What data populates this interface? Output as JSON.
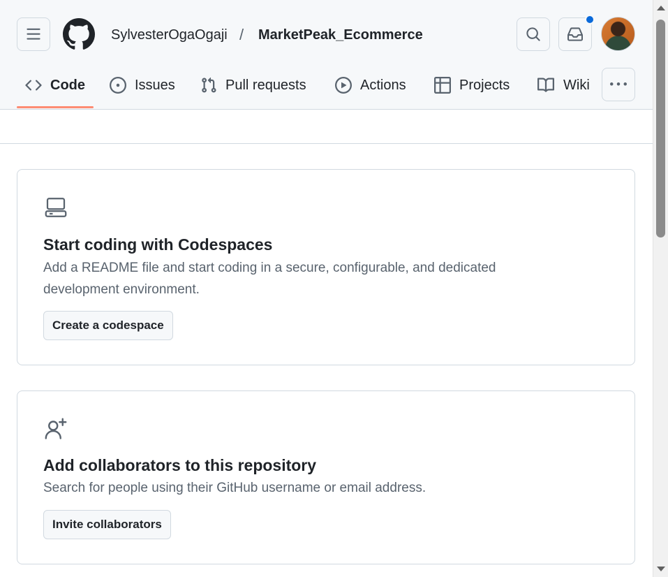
{
  "header": {
    "owner": "SylvesterOgaOgaji",
    "separator": "/",
    "repo": "MarketPeak_Ecommerce"
  },
  "icons": {
    "menu": "hamburger-icon",
    "logo": "github-mark-icon",
    "search": "search-icon",
    "inbox": "inbox-icon",
    "more": "kebab-horizontal-icon"
  },
  "colors": {
    "accent_underline": "#fd8c73",
    "notification_dot": "#0969da",
    "header_bg": "#f6f8fa",
    "muted_text": "#59636e"
  },
  "tabs": [
    {
      "label": "Code",
      "icon": "code-icon",
      "selected": true
    },
    {
      "label": "Issues",
      "icon": "issue-opened-icon",
      "selected": false
    },
    {
      "label": "Pull requests",
      "icon": "git-pull-request-icon",
      "selected": false
    },
    {
      "label": "Actions",
      "icon": "play-icon",
      "selected": false
    },
    {
      "label": "Projects",
      "icon": "table-icon",
      "selected": false
    },
    {
      "label": "Wiki",
      "icon": "book-icon",
      "selected": false
    }
  ],
  "cards": [
    {
      "icon": "device-desktop-icon",
      "title": "Start coding with Codespaces",
      "description": "Add a README file and start coding in a secure, configurable, and dedicated development environment.",
      "button": "Create a codespace"
    },
    {
      "icon": "person-add-icon",
      "title": "Add collaborators to this repository",
      "description": "Search for people using their GitHub username or email address.",
      "button": "Invite collaborators"
    }
  ]
}
